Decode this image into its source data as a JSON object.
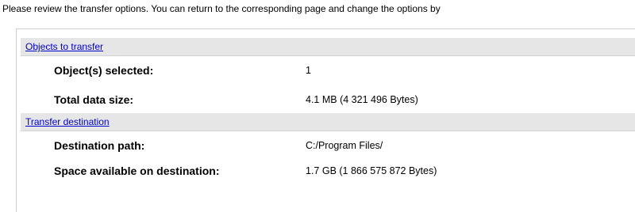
{
  "instructions": "Please review the transfer options. You can return to the corresponding page and change the options by",
  "sections": [
    {
      "title": "Objects to transfer",
      "rows": [
        {
          "label": "Object(s) selected:",
          "value": "1"
        },
        {
          "label": "Total data size:",
          "value": "4.1 MB (4 321 496 Bytes)"
        }
      ]
    },
    {
      "title": "Transfer destination",
      "rows": [
        {
          "label": "Destination path:",
          "value": "C:/Program Files/"
        },
        {
          "label": "Space available on destination:",
          "value": "1.7 GB (1 866 575 872 Bytes)"
        }
      ]
    }
  ],
  "colors": {
    "link": "#0000cc",
    "section_header_bg": "#e6e6e6"
  }
}
